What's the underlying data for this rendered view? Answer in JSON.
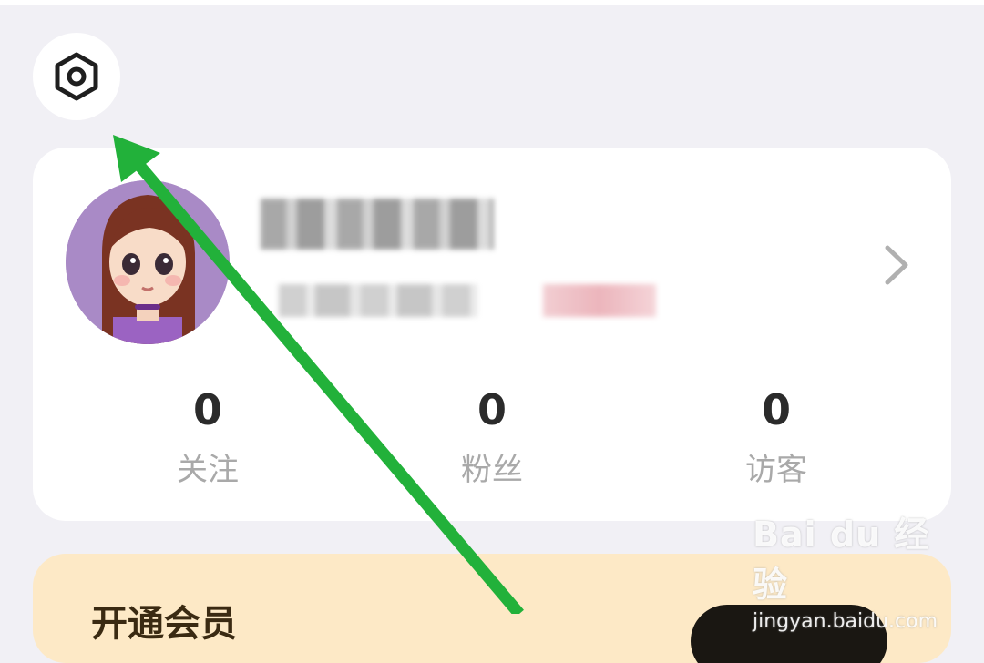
{
  "header": {
    "settings_icon": "hexagon-settings-icon"
  },
  "profile": {
    "avatar": "cartoon-girl-avatar",
    "username": "",
    "user_id": "",
    "tag": "",
    "chevron_icon": "chevron-right-icon",
    "stats": [
      {
        "value": "0",
        "label": "关注"
      },
      {
        "value": "0",
        "label": "粉丝"
      },
      {
        "value": "0",
        "label": "访客"
      }
    ]
  },
  "vip": {
    "title": "开通会员",
    "background_color": "#fde9c6"
  },
  "annotation": {
    "arrow_color": "#22b13a"
  },
  "watermark": {
    "logo": "Bai du 经验",
    "url": "jingyan.baidu.com"
  }
}
